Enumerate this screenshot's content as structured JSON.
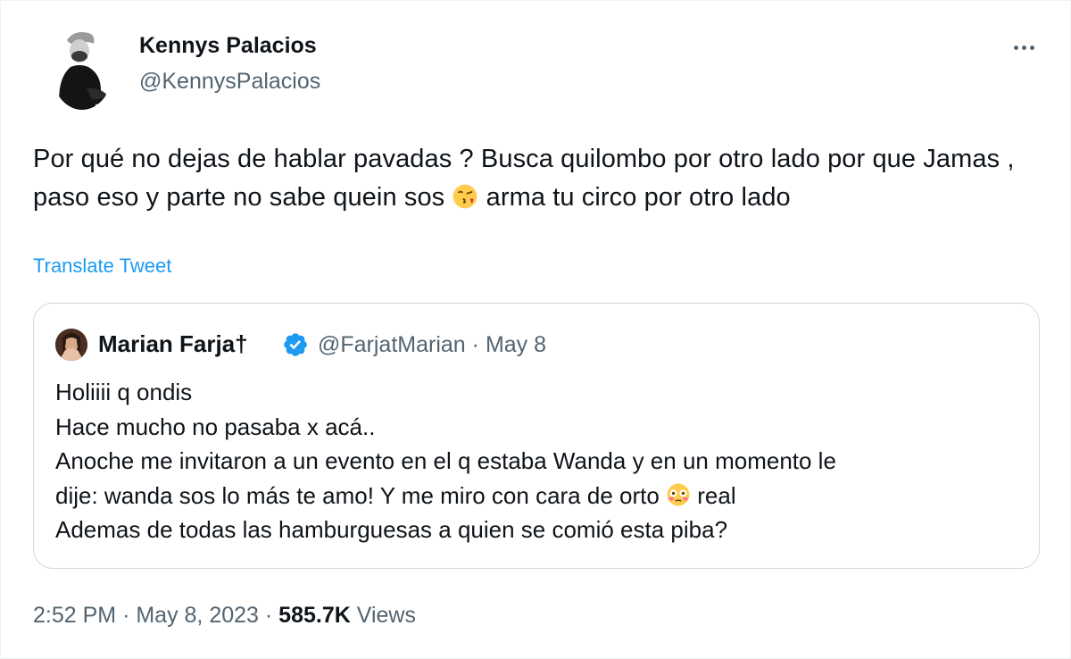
{
  "author": {
    "name": "Kennys Palacios",
    "handle": "@KennysPalacios"
  },
  "tweet": {
    "text_part1": "Por qué no dejas de hablar pavadas ? Busca quilombo por otro lado por que Jamas , paso eso y parte no sabe quein sos ",
    "emoji1": "face-blowing-kiss",
    "text_part2": "  arma tu circo por otro lado",
    "translate_label": "Translate Tweet"
  },
  "quoted": {
    "name": "Marian Farja†",
    "handle": "@FarjatMarian",
    "separator": "·",
    "date": "May 8",
    "lines": [
      "Holiiii q ondis",
      "Hace mucho no pasaba x acá..",
      "Anoche me invitaron a un evento en el q estaba Wanda y en un momento le",
      "dije: wanda sos lo más te amo! Y me miro con cara de orto",
      "Ademas de todas las hamburguesas a quien se comió esta piba?"
    ],
    "line4_suffix": " real",
    "emoji2": "flushed-face"
  },
  "footer": {
    "time": "2:52 PM",
    "sep1": "·",
    "date": "May 8, 2023",
    "sep2": "·",
    "views_count": "585.7K",
    "views_label": "Views"
  },
  "colors": {
    "accent": "#1d9bf0",
    "secondary_text": "#536471",
    "border": "#cfd9de"
  }
}
